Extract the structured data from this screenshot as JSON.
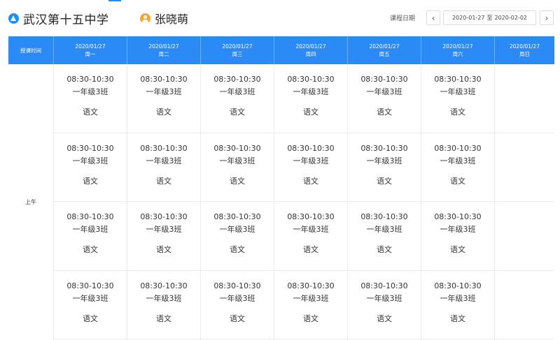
{
  "header": {
    "school_icon": "school-icon",
    "school_name": "武汉第十五中学",
    "teacher_icon": "user-icon",
    "teacher_name": "张晓萌",
    "date_label": "课程日期",
    "date_start": "2020-01-27",
    "date_sep": "至",
    "date_end": "2020-02-02",
    "prev_icon": "chevron-left-icon",
    "next_icon": "chevron-right-icon",
    "accent_color": "#2b8af5"
  },
  "table": {
    "time_header": "授课时间",
    "days": [
      {
        "date": "2020/01/27",
        "weekday": "周一"
      },
      {
        "date": "2020/01/27",
        "weekday": "周二"
      },
      {
        "date": "2020/01/27",
        "weekday": "周三"
      },
      {
        "date": "2020/01/27",
        "weekday": "周四"
      },
      {
        "date": "2020/01/27",
        "weekday": "周五"
      },
      {
        "date": "2020/01/27",
        "weekday": "周六"
      },
      {
        "date": "2020/01/27",
        "weekday": "周日"
      }
    ],
    "period": "上午",
    "slots": [
      [
        {
          "time": "08:30-10:30",
          "class": "一年级3班",
          "subject": "语文"
        },
        {
          "time": "08:30-10:30",
          "class": "一年级3班",
          "subject": "语文"
        },
        {
          "time": "08:30-10:30",
          "class": "一年级3班",
          "subject": "语文"
        },
        {
          "time": "08:30-10:30",
          "class": "一年级3班",
          "subject": "语文"
        }
      ],
      [
        {
          "time": "08:30-10:30",
          "class": "一年级3班",
          "subject": "语文"
        },
        {
          "time": "08:30-10:30",
          "class": "一年级3班",
          "subject": "语文"
        },
        {
          "time": "08:30-10:30",
          "class": "一年级3班",
          "subject": "语文"
        },
        {
          "time": "08:30-10:30",
          "class": "一年级3班",
          "subject": "语文"
        }
      ],
      [
        {
          "time": "08:30-10:30",
          "class": "一年级3班",
          "subject": "语文"
        },
        {
          "time": "08:30-10:30",
          "class": "一年级3班",
          "subject": "语文"
        },
        {
          "time": "08:30-10:30",
          "class": "一年级3班",
          "subject": "语文"
        },
        {
          "time": "08:30-10:30",
          "class": "一年级3班",
          "subject": "语文"
        }
      ],
      [
        {
          "time": "08:30-10:30",
          "class": "一年级3班",
          "subject": "语文"
        },
        {
          "time": "08:30-10:30",
          "class": "一年级3班",
          "subject": "语文"
        },
        {
          "time": "08:30-10:30",
          "class": "一年级3班",
          "subject": "语文"
        },
        {
          "time": "08:30-10:30",
          "class": "一年级3班",
          "subject": "语文"
        }
      ],
      [
        {
          "time": "08:30-10:30",
          "class": "一年级3班",
          "subject": "语文"
        },
        {
          "time": "08:30-10:30",
          "class": "一年级3班",
          "subject": "语文"
        },
        {
          "time": "08:30-10:30",
          "class": "一年级3班",
          "subject": "语文"
        },
        {
          "time": "08:30-10:30",
          "class": "一年级3班",
          "subject": "语文"
        }
      ],
      [
        {
          "time": "08:30-10:30",
          "class": "一年级3班",
          "subject": "语文"
        },
        {
          "time": "08:30-10:30",
          "class": "一年级3班",
          "subject": "语文"
        },
        {
          "time": "08:30-10:30",
          "class": "一年级3班",
          "subject": "语文"
        },
        {
          "time": "08:30-10:30",
          "class": "一年级3班",
          "subject": "语文"
        }
      ],
      [
        {},
        {},
        {},
        {}
      ]
    ]
  }
}
